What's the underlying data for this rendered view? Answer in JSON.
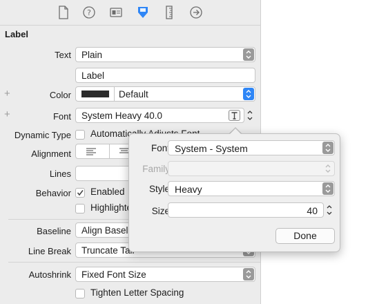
{
  "inspector": {
    "section_title": "Label",
    "toolbar_icons": [
      "file-icon",
      "help-icon",
      "identity-icon",
      "attributes-icon",
      "size-ruler-icon",
      "connections-icon"
    ],
    "text": {
      "label": "Text",
      "value": "Plain"
    },
    "text_value": "Label",
    "color": {
      "label": "Color",
      "value": "Default",
      "swatch": "#2b2b2b"
    },
    "font": {
      "label": "Font",
      "value": "System Heavy 40.0"
    },
    "dynamic_type": {
      "label": "Dynamic Type",
      "checkbox_label": "Automatically Adjusts Font"
    },
    "alignment": {
      "label": "Alignment"
    },
    "lines": {
      "label": "Lines"
    },
    "behavior": {
      "label": "Behavior",
      "enabled_label": "Enabled",
      "highlighted_label": "Highlighted"
    },
    "baseline": {
      "label": "Baseline",
      "value": "Align Baselines"
    },
    "line_break": {
      "label": "Line Break",
      "value": "Truncate Tail"
    },
    "autoshrink": {
      "label": "Autoshrink",
      "value": "Fixed Font Size"
    },
    "tighten": {
      "label": "Tighten Letter Spacing"
    }
  },
  "popover": {
    "font": {
      "label": "Font",
      "value": "System - System"
    },
    "family": {
      "label": "Family",
      "value": ""
    },
    "style": {
      "label": "Style",
      "value": "Heavy"
    },
    "size": {
      "label": "Size",
      "value": "40"
    },
    "done_label": "Done"
  },
  "colors": {
    "accent": "#2f86f6",
    "panel": "#ececec"
  }
}
